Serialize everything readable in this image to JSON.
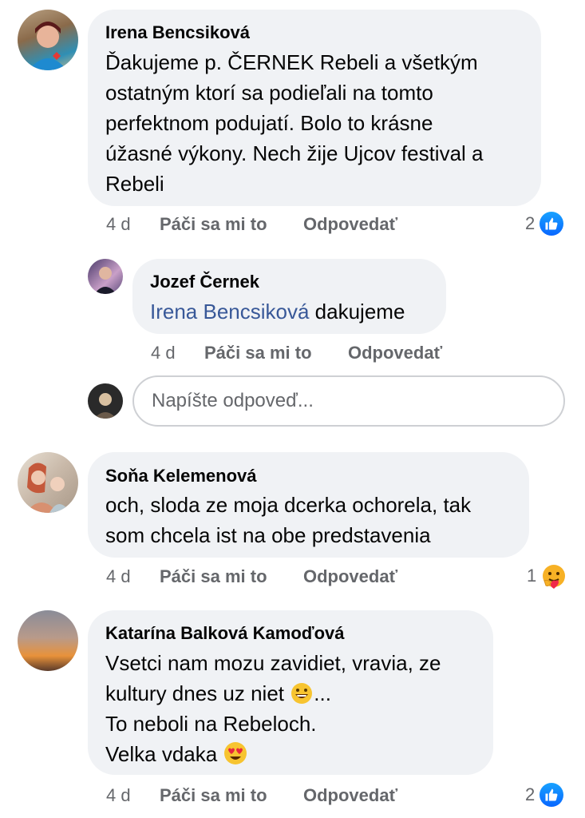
{
  "comments": [
    {
      "author": "Irena Bencsiková",
      "lines": [
        "Ďakujeme p. ČERNEK Rebeli a všetkým",
        "ostatným ktorí sa podieľali na tomto",
        "perfektnom podujatí. Bolo to krásne",
        "úžasné výkony. Nech žije Ujcov festival a",
        "Rebeli"
      ],
      "time": "4 d",
      "like_label": "Páči sa mi to",
      "reply_label": "Odpovedať",
      "reaction_count": "2",
      "reaction_icon": "like-icon"
    },
    {
      "author": "Jozef Černek",
      "mention": "Irena Bencsiková",
      "text": " dakujeme",
      "time": "4 d",
      "like_label": "Páči sa mi to",
      "reply_label": "Odpovedať"
    },
    {
      "author": "Soňa Kelemenová",
      "lines": [
        "och, sloda ze moja dcerka ochorela, tak",
        "som chcela ist na obe predstavenia"
      ],
      "time": "4 d",
      "like_label": "Páči sa mi to",
      "reply_label": "Odpovedať",
      "reaction_count": "1",
      "reaction_icon": "care-icon"
    },
    {
      "author": "Katarína Balková Kamoďová",
      "lines": [
        "Vsetci nam mozu zavidiet, vravia, ze",
        "kultury dnes uz niet",
        "To neboli na Rebeloch.",
        "Velka vdaka"
      ],
      "line2_suffix": "...",
      "time": "4 d",
      "like_label": "Páči sa mi to",
      "reply_label": "Odpovedať",
      "reaction_count": "2",
      "reaction_icon": "like-icon"
    }
  ],
  "reply_box": {
    "placeholder": "Napíšte odpoveď..."
  },
  "colors": {
    "bubble": "#f0f2f5",
    "meta": "#65676b",
    "mention": "#385898",
    "like": "#0866ff"
  }
}
